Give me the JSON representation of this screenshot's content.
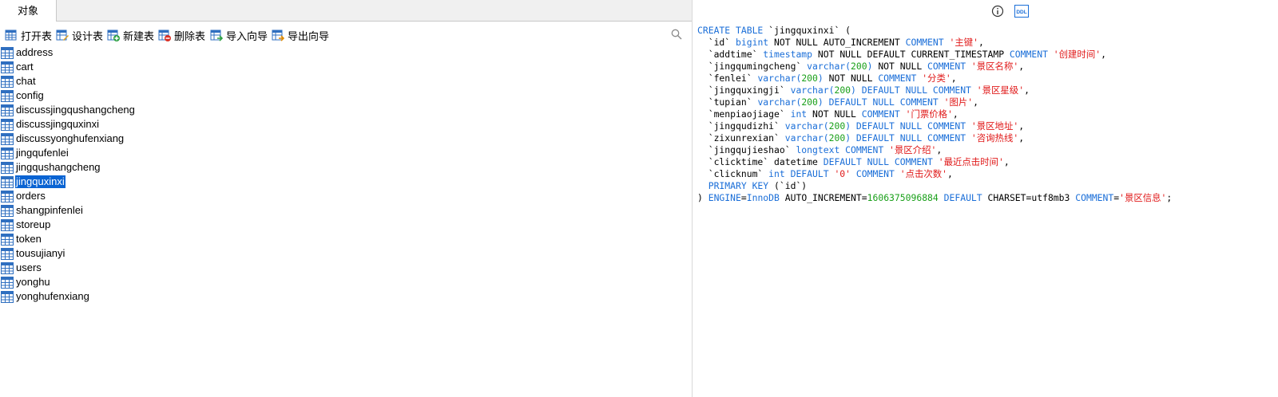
{
  "tab": {
    "label": "对象"
  },
  "toolbar": {
    "open": "打开表",
    "design": "设计表",
    "new": "新建表",
    "delete": "删除表",
    "import": "导入向导",
    "export": "导出向导"
  },
  "tables": [
    "address",
    "cart",
    "chat",
    "config",
    "discussjingqushangcheng",
    "discussjingquxinxi",
    "discussyonghufenxiang",
    "jingqufenlei",
    "jingqushangcheng",
    "jingquxinxi",
    "orders",
    "shangpinfenlei",
    "storeup",
    "token",
    "tousujianyi",
    "users",
    "yonghu",
    "yonghufenxiang"
  ],
  "selected_table": "jingquxinxi",
  "ddl_badge": "DDL",
  "ddl_lines": [
    [
      [
        "k",
        "CREATE TABLE "
      ],
      [
        "t",
        "`jingquxinxi` ("
      ]
    ],
    [
      [
        "t",
        "  `id` "
      ],
      [
        "k",
        "bigint"
      ],
      [
        "t",
        " NOT NULL AUTO_INCREMENT "
      ],
      [
        "k",
        "COMMENT"
      ],
      [
        "s",
        " '主键'"
      ],
      [
        "t",
        ","
      ]
    ],
    [
      [
        "t",
        "  `addtime` "
      ],
      [
        "k",
        "timestamp"
      ],
      [
        "t",
        " NOT NULL DEFAULT CURRENT_TIMESTAMP "
      ],
      [
        "k",
        "COMMENT"
      ],
      [
        "s",
        " '创建时间'"
      ],
      [
        "t",
        ","
      ]
    ],
    [
      [
        "t",
        "  `jingqumingcheng` "
      ],
      [
        "k",
        "varchar("
      ],
      [
        "n",
        "200"
      ],
      [
        "k",
        ")"
      ],
      [
        "t",
        " NOT NULL "
      ],
      [
        "k",
        "COMMENT"
      ],
      [
        "s",
        " '景区名称'"
      ],
      [
        "t",
        ","
      ]
    ],
    [
      [
        "t",
        "  `fenlei` "
      ],
      [
        "k",
        "varchar("
      ],
      [
        "n",
        "200"
      ],
      [
        "k",
        ")"
      ],
      [
        "t",
        " NOT NULL "
      ],
      [
        "k",
        "COMMENT"
      ],
      [
        "s",
        " '分类'"
      ],
      [
        "t",
        ","
      ]
    ],
    [
      [
        "t",
        "  `jingquxingji` "
      ],
      [
        "k",
        "varchar("
      ],
      [
        "n",
        "200"
      ],
      [
        "k",
        ")"
      ],
      [
        "k",
        " DEFAULT NULL COMMENT"
      ],
      [
        "s",
        " '景区星级'"
      ],
      [
        "t",
        ","
      ]
    ],
    [
      [
        "t",
        "  `tupian` "
      ],
      [
        "k",
        "varchar("
      ],
      [
        "n",
        "200"
      ],
      [
        "k",
        ")"
      ],
      [
        "k",
        " DEFAULT NULL COMMENT"
      ],
      [
        "s",
        " '图片'"
      ],
      [
        "t",
        ","
      ]
    ],
    [
      [
        "t",
        "  `menpiaojiage` "
      ],
      [
        "k",
        "int"
      ],
      [
        "t",
        " NOT NULL "
      ],
      [
        "k",
        "COMMENT"
      ],
      [
        "s",
        " '门票价格'"
      ],
      [
        "t",
        ","
      ]
    ],
    [
      [
        "t",
        "  `jingqudizhi` "
      ],
      [
        "k",
        "varchar("
      ],
      [
        "n",
        "200"
      ],
      [
        "k",
        ")"
      ],
      [
        "k",
        " DEFAULT NULL COMMENT"
      ],
      [
        "s",
        " '景区地址'"
      ],
      [
        "t",
        ","
      ]
    ],
    [
      [
        "t",
        "  `zixunrexian` "
      ],
      [
        "k",
        "varchar("
      ],
      [
        "n",
        "200"
      ],
      [
        "k",
        ")"
      ],
      [
        "k",
        " DEFAULT NULL COMMENT"
      ],
      [
        "s",
        " '咨询热线'"
      ],
      [
        "t",
        ","
      ]
    ],
    [
      [
        "t",
        "  `jingqujieshao` "
      ],
      [
        "k",
        "longtext"
      ],
      [
        "k",
        " COMMENT"
      ],
      [
        "s",
        " '景区介绍'"
      ],
      [
        "t",
        ","
      ]
    ],
    [
      [
        "t",
        "  `clicktime` datetime "
      ],
      [
        "k",
        "DEFAULT NULL COMMENT"
      ],
      [
        "s",
        " '最近点击时间'"
      ],
      [
        "t",
        ","
      ]
    ],
    [
      [
        "t",
        "  `clicknum` "
      ],
      [
        "k",
        "int DEFAULT"
      ],
      [
        "s",
        " '0'"
      ],
      [
        "k",
        " COMMENT"
      ],
      [
        "s",
        " '点击次数'"
      ],
      [
        "t",
        ","
      ]
    ],
    [
      [
        "k",
        "  PRIMARY KEY "
      ],
      [
        "t",
        "(`id`)"
      ]
    ],
    [
      [
        "t",
        ") "
      ],
      [
        "k",
        "ENGINE"
      ],
      [
        "t",
        "="
      ],
      [
        "k",
        "InnoDB"
      ],
      [
        "t",
        " AUTO_INCREMENT="
      ],
      [
        "n",
        "1606375096884"
      ],
      [
        "k",
        " DEFAULT"
      ],
      [
        "t",
        " CHARSET=utf8mb3 "
      ],
      [
        "k",
        "COMMENT"
      ],
      [
        "t",
        "="
      ],
      [
        "s",
        "'景区信息'"
      ],
      [
        "t",
        ";"
      ]
    ]
  ]
}
